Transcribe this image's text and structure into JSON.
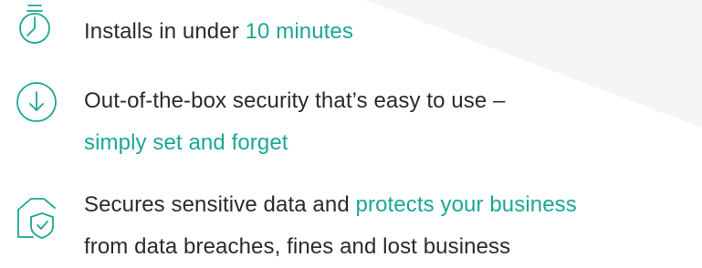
{
  "colors": {
    "accent": "#1ba891",
    "text": "#2b2b2b",
    "background": "#ffffff",
    "background_shape": "#f4f5f6"
  },
  "features": [
    {
      "icon": "stopwatch-icon",
      "text_before": "Installs in under ",
      "highlight": "10 minutes",
      "text_after": ""
    },
    {
      "icon": "download-arrow-icon",
      "line1": "Out-of-the-box security that’s easy to use –",
      "highlight": "simply set and forget"
    },
    {
      "icon": "shield-house-icon",
      "text_before": "Secures sensitive data and ",
      "highlight": "protects your business",
      "line2": "from data breaches, fines and lost business"
    }
  ]
}
